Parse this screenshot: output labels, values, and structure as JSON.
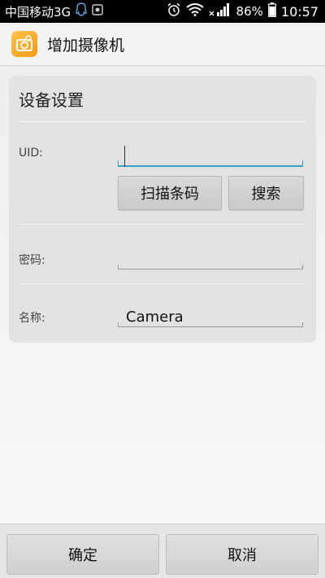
{
  "status_bar": {
    "carrier": "中国移动3G",
    "battery": "86%",
    "time": "10:57",
    "icons": [
      "qq-icon",
      "notification-icon",
      "alarm-icon",
      "wifi-icon",
      "signal-icon",
      "battery-icon"
    ]
  },
  "action_bar": {
    "title": "增加摄像机",
    "icon": "camera-app-icon"
  },
  "device_settings": {
    "title": "设备设置",
    "uid_label": "UID:",
    "uid_value": "",
    "scan_button": "扫描条码",
    "search_button": "搜索",
    "password_label": "密码:",
    "password_value": "",
    "name_label": "名称:",
    "name_value": "Camera"
  },
  "footer": {
    "confirm": "确定",
    "cancel": "取消"
  },
  "colors": {
    "accent": "#35a0c8",
    "app_icon": "#f5a623"
  }
}
